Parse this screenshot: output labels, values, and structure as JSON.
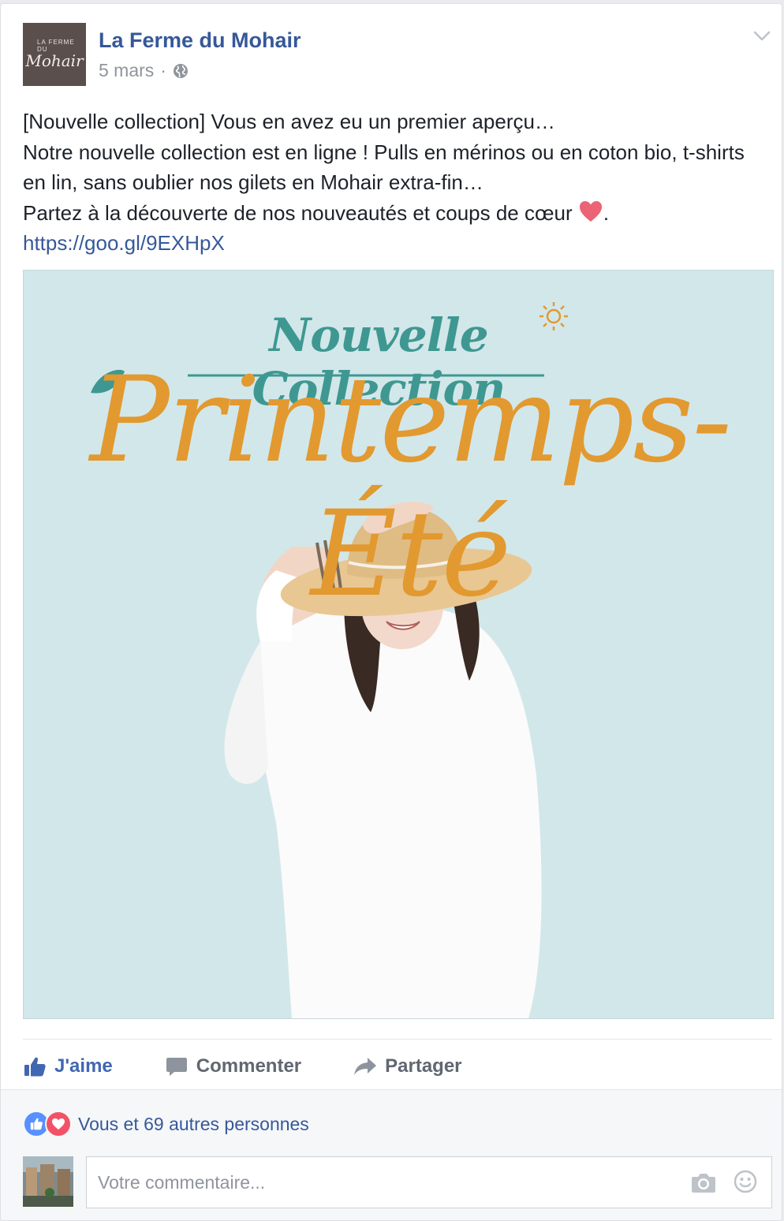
{
  "post": {
    "avatar": {
      "top_text": "LA FERME DU",
      "logo_text": "Mohair"
    },
    "page_name": "La Ferme du Mohair",
    "date": "5 mars",
    "separator": "·",
    "privacy_icon": "globe-icon",
    "menu_icon": "chevron-down-icon",
    "text_lines": [
      "[Nouvelle collection] Vous en avez eu un premier aperçu…",
      "Notre nouvelle collection est en ligne ! Pulls en mérinos ou en coton bio, t-shirts en lin, sans oublier nos gilets en Mohair extra-fin…",
      "Partez à la découverte de nos nouveautés et coups de cœur"
    ],
    "emoji": "heart-emoji",
    "line_end": ".",
    "link": "https://goo.gl/9EXHpX"
  },
  "image": {
    "title_small": "Nouvelle Collection",
    "title_big": "Printemps-Été",
    "background": "#d2e7ea",
    "accent_orange": "#e2992f",
    "accent_teal": "#3e9891"
  },
  "actions": {
    "like_label": "J'aime",
    "comment_label": "Commenter",
    "share_label": "Partager"
  },
  "reactions": {
    "icons": [
      "like-reaction-icon",
      "love-reaction-icon"
    ],
    "text": "Vous et 69 autres personnes"
  },
  "comment": {
    "placeholder": "Votre commentaire..."
  },
  "colors": {
    "link_blue": "#365899",
    "like_blue": "#4267b2",
    "muted": "#90949c"
  }
}
